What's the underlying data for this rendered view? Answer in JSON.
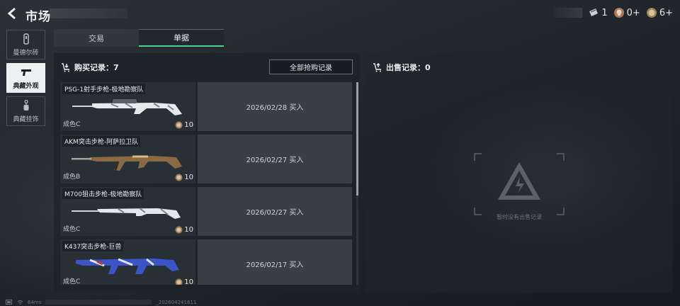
{
  "title": "市场",
  "currencies": [
    {
      "icon": "ticket-icon",
      "value": "1"
    },
    {
      "icon": "skull-coin-icon",
      "value": "0+"
    },
    {
      "icon": "gold-coin-icon",
      "value": "6+"
    }
  ],
  "sidebar": {
    "items": [
      {
        "label": "曼德尔砖",
        "icon": "brick-icon",
        "active": false
      },
      {
        "label": "典藏外观",
        "icon": "pistol-icon",
        "active": true
      },
      {
        "label": "典藏挂饰",
        "icon": "charm-icon",
        "active": false
      }
    ]
  },
  "tabs": [
    {
      "label": "交易",
      "active": false
    },
    {
      "label": "单据",
      "active": true
    }
  ],
  "buy": {
    "title": "购买记录：7",
    "all_button": "全部抢购记录",
    "records": [
      {
        "name": "PSG-1射手步枪-极地勘察队",
        "grade": "成色C",
        "price": "10",
        "date": "2026/02/28 买入"
      },
      {
        "name": "AKM突击步枪-阿萨拉卫队",
        "grade": "成色B",
        "price": "10",
        "date": "2026/02/27 买入"
      },
      {
        "name": "M700狙击步枪-极地勘察队",
        "grade": "成色C",
        "price": "10",
        "date": "2026/02/27 买入"
      },
      {
        "name": "K437突击步枪-巨兽",
        "grade": "成色C",
        "price": "10",
        "date": "2026/02/17 买入"
      }
    ]
  },
  "sell": {
    "title": "出售记录：0",
    "empty_text": "暂时没有出售记录"
  },
  "status": {
    "ping": "64ms",
    "build": "_202604241611"
  },
  "colors": {
    "accent": "#4fd08a",
    "panel": "#1e2327"
  }
}
